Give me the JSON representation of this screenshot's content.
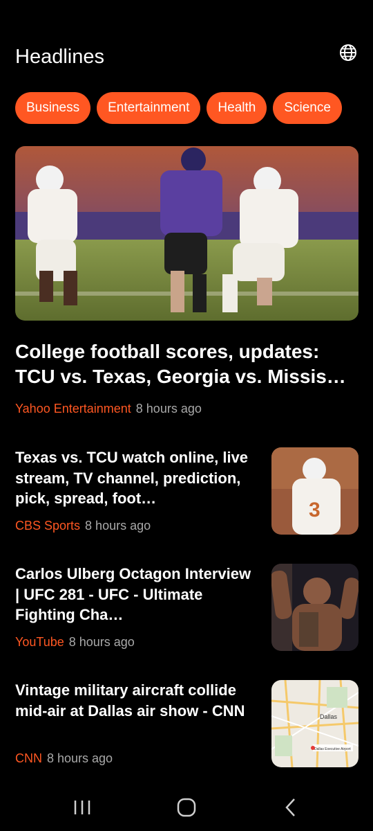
{
  "header": {
    "title": "Headlines",
    "globe_icon": "globe-icon"
  },
  "categories": [
    "Business",
    "Entertainment",
    "Health",
    "Science"
  ],
  "featured": {
    "title": "College football scores, updates: TCU vs. Texas, Georgia vs. Missis…",
    "source": "Yahoo Entertainment",
    "time": "8 hours ago"
  },
  "articles": [
    {
      "title": "Texas vs. TCU watch online, live stream, TV channel, prediction, pick, spread, foot…",
      "source": "CBS Sports",
      "time": "8 hours ago"
    },
    {
      "title": "Carlos Ulberg Octagon Interview | UFC 281 - UFC - Ultimate Fighting Cha…",
      "source": "YouTube",
      "time": "8 hours ago"
    },
    {
      "title": "Vintage military aircraft collide mid-air at Dallas air show - CNN",
      "source": "CNN",
      "time": "8 hours ago"
    }
  ],
  "map_thumbnail": {
    "city_label": "Dallas",
    "airport_label": "Dallas Executive Airport"
  },
  "navigation": {
    "recents_icon": "recents-icon",
    "home_icon": "home-icon",
    "back_icon": "back-icon"
  },
  "colors": {
    "accent": "#ff5722",
    "background": "#000000",
    "meta_text": "#a9a9a9"
  }
}
